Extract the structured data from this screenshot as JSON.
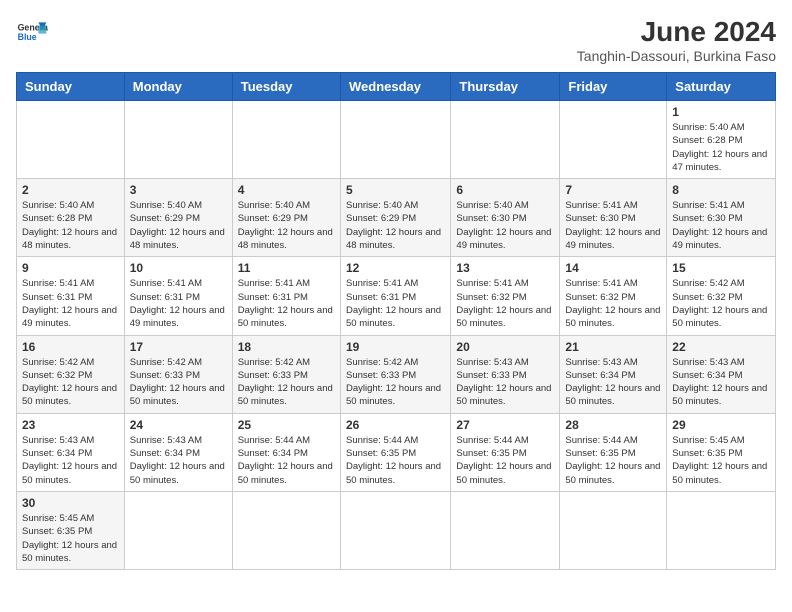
{
  "header": {
    "logo_general": "General",
    "logo_blue": "Blue",
    "month_year": "June 2024",
    "location": "Tanghin-Dassouri, Burkina Faso"
  },
  "weekdays": [
    "Sunday",
    "Monday",
    "Tuesday",
    "Wednesday",
    "Thursday",
    "Friday",
    "Saturday"
  ],
  "weeks": [
    [
      {
        "day": "",
        "info": ""
      },
      {
        "day": "",
        "info": ""
      },
      {
        "day": "",
        "info": ""
      },
      {
        "day": "",
        "info": ""
      },
      {
        "day": "",
        "info": ""
      },
      {
        "day": "",
        "info": ""
      },
      {
        "day": "1",
        "info": "Sunrise: 5:40 AM\nSunset: 6:28 PM\nDaylight: 12 hours and 47 minutes."
      }
    ],
    [
      {
        "day": "2",
        "info": "Sunrise: 5:40 AM\nSunset: 6:28 PM\nDaylight: 12 hours and 48 minutes."
      },
      {
        "day": "3",
        "info": "Sunrise: 5:40 AM\nSunset: 6:29 PM\nDaylight: 12 hours and 48 minutes."
      },
      {
        "day": "4",
        "info": "Sunrise: 5:40 AM\nSunset: 6:29 PM\nDaylight: 12 hours and 48 minutes."
      },
      {
        "day": "5",
        "info": "Sunrise: 5:40 AM\nSunset: 6:29 PM\nDaylight: 12 hours and 48 minutes."
      },
      {
        "day": "6",
        "info": "Sunrise: 5:40 AM\nSunset: 6:30 PM\nDaylight: 12 hours and 49 minutes."
      },
      {
        "day": "7",
        "info": "Sunrise: 5:41 AM\nSunset: 6:30 PM\nDaylight: 12 hours and 49 minutes."
      },
      {
        "day": "8",
        "info": "Sunrise: 5:41 AM\nSunset: 6:30 PM\nDaylight: 12 hours and 49 minutes."
      }
    ],
    [
      {
        "day": "9",
        "info": "Sunrise: 5:41 AM\nSunset: 6:31 PM\nDaylight: 12 hours and 49 minutes."
      },
      {
        "day": "10",
        "info": "Sunrise: 5:41 AM\nSunset: 6:31 PM\nDaylight: 12 hours and 49 minutes."
      },
      {
        "day": "11",
        "info": "Sunrise: 5:41 AM\nSunset: 6:31 PM\nDaylight: 12 hours and 50 minutes."
      },
      {
        "day": "12",
        "info": "Sunrise: 5:41 AM\nSunset: 6:31 PM\nDaylight: 12 hours and 50 minutes."
      },
      {
        "day": "13",
        "info": "Sunrise: 5:41 AM\nSunset: 6:32 PM\nDaylight: 12 hours and 50 minutes."
      },
      {
        "day": "14",
        "info": "Sunrise: 5:41 AM\nSunset: 6:32 PM\nDaylight: 12 hours and 50 minutes."
      },
      {
        "day": "15",
        "info": "Sunrise: 5:42 AM\nSunset: 6:32 PM\nDaylight: 12 hours and 50 minutes."
      }
    ],
    [
      {
        "day": "16",
        "info": "Sunrise: 5:42 AM\nSunset: 6:32 PM\nDaylight: 12 hours and 50 minutes."
      },
      {
        "day": "17",
        "info": "Sunrise: 5:42 AM\nSunset: 6:33 PM\nDaylight: 12 hours and 50 minutes."
      },
      {
        "day": "18",
        "info": "Sunrise: 5:42 AM\nSunset: 6:33 PM\nDaylight: 12 hours and 50 minutes."
      },
      {
        "day": "19",
        "info": "Sunrise: 5:42 AM\nSunset: 6:33 PM\nDaylight: 12 hours and 50 minutes."
      },
      {
        "day": "20",
        "info": "Sunrise: 5:43 AM\nSunset: 6:33 PM\nDaylight: 12 hours and 50 minutes."
      },
      {
        "day": "21",
        "info": "Sunrise: 5:43 AM\nSunset: 6:34 PM\nDaylight: 12 hours and 50 minutes."
      },
      {
        "day": "22",
        "info": "Sunrise: 5:43 AM\nSunset: 6:34 PM\nDaylight: 12 hours and 50 minutes."
      }
    ],
    [
      {
        "day": "23",
        "info": "Sunrise: 5:43 AM\nSunset: 6:34 PM\nDaylight: 12 hours and 50 minutes."
      },
      {
        "day": "24",
        "info": "Sunrise: 5:43 AM\nSunset: 6:34 PM\nDaylight: 12 hours and 50 minutes."
      },
      {
        "day": "25",
        "info": "Sunrise: 5:44 AM\nSunset: 6:34 PM\nDaylight: 12 hours and 50 minutes."
      },
      {
        "day": "26",
        "info": "Sunrise: 5:44 AM\nSunset: 6:35 PM\nDaylight: 12 hours and 50 minutes."
      },
      {
        "day": "27",
        "info": "Sunrise: 5:44 AM\nSunset: 6:35 PM\nDaylight: 12 hours and 50 minutes."
      },
      {
        "day": "28",
        "info": "Sunrise: 5:44 AM\nSunset: 6:35 PM\nDaylight: 12 hours and 50 minutes."
      },
      {
        "day": "29",
        "info": "Sunrise: 5:45 AM\nSunset: 6:35 PM\nDaylight: 12 hours and 50 minutes."
      }
    ],
    [
      {
        "day": "30",
        "info": "Sunrise: 5:45 AM\nSunset: 6:35 PM\nDaylight: 12 hours and 50 minutes."
      },
      {
        "day": "",
        "info": ""
      },
      {
        "day": "",
        "info": ""
      },
      {
        "day": "",
        "info": ""
      },
      {
        "day": "",
        "info": ""
      },
      {
        "day": "",
        "info": ""
      },
      {
        "day": "",
        "info": ""
      }
    ]
  ]
}
